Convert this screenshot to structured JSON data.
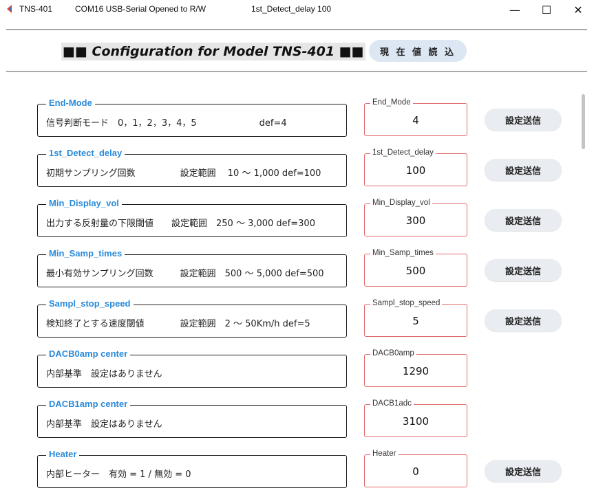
{
  "titlebar": {
    "app_name": "TNS-401",
    "port_info": "COM16  USB-Serial Opened to R/W",
    "status": "1st_Detect_delay  100",
    "minimize": "—",
    "maximize": "☐",
    "close": "✕",
    "icon": "app-logo-icon",
    "icon_colors": [
      "#e8463b",
      "#2e73c8"
    ]
  },
  "header": {
    "title": "■■ Configuration for Model TNS-401 ■■",
    "read_button_label": "現 在 値 読 込"
  },
  "rows": [
    {
      "label": "End-Mode",
      "desc": "信号判断モード　0，1，2，3，4，5　　　　　　　def=4",
      "field_label": "End_Mode",
      "value": "4",
      "send_label": "設定送信"
    },
    {
      "label": "1st_Detect_delay",
      "desc": "初期サンプリング回数　　　　　設定範囲　 10 ～ 1,000 def=100",
      "field_label": "1st_Detect_delay",
      "value": "100",
      "send_label": "設定送信"
    },
    {
      "label": "Min_Display_vol",
      "desc": "出力する反射量の下限閾値　　設定範囲　250 ～ 3,000 def=300",
      "field_label": "Min_Display_vol",
      "value": "300",
      "send_label": "設定送信"
    },
    {
      "label": "Min_Samp_times",
      "desc": "最小有効サンプリング回数　　　設定範囲　500 ～ 5,000 def=500",
      "field_label": "Min_Samp_times",
      "value": "500",
      "send_label": "設定送信"
    },
    {
      "label": "Sampl_stop_speed",
      "desc": "検知終了とする速度閾値　　　　設定範囲　2 ～ 50Km/h def=5",
      "field_label": "Sampl_stop_speed",
      "value": "5",
      "send_label": "設定送信"
    },
    {
      "label": "DACB0amp center",
      "desc": "内部基準　設定はありません",
      "field_label": "DACB0amp",
      "value": "1290",
      "send_label": ""
    },
    {
      "label": "DACB1amp center",
      "desc": "内部基準　設定はありません",
      "field_label": "DACB1adc",
      "value": "3100",
      "send_label": ""
    },
    {
      "label": "Heater",
      "desc": "内部ヒーター　有効 = 1 / 無効 = 0",
      "field_label": "Heater",
      "value": "0",
      "send_label": "設定送信"
    }
  ]
}
